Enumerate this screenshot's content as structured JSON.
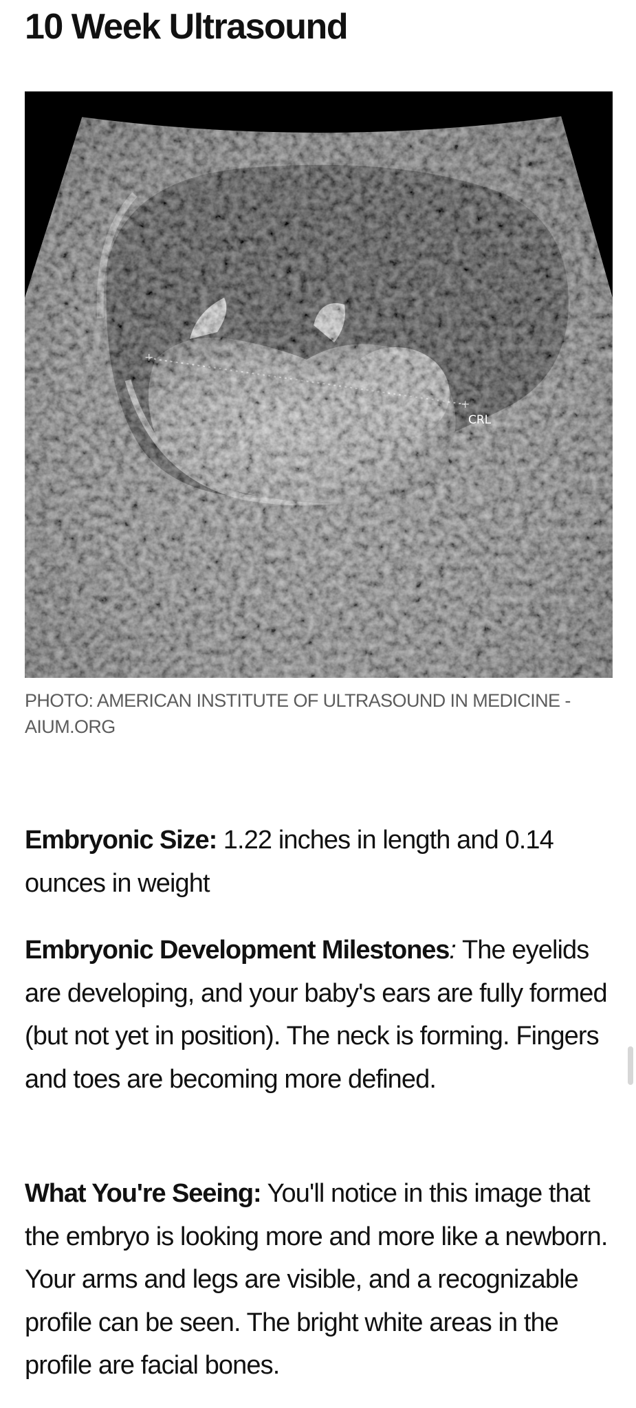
{
  "article": {
    "title": "10 Week Ultrasound",
    "image": {
      "alt": "10 week ultrasound",
      "overlay_label": "CRL"
    },
    "caption": "PHOTO: AMERICAN INSTITUTE OF ULTRASOUND IN MEDICINE - AIUM.ORG",
    "sections": [
      {
        "label": "Embryonic Size:",
        "text": " 1.22 inches in length and 0.14 ounces in weight"
      },
      {
        "label": "Embryonic Development Milestones",
        "label_suffix": ":",
        "text": " The eyelids are developing, and your baby's ears are fully formed (but not yet in position). The neck is forming. Fingers and toes are becoming more defined."
      },
      {
        "label": "What You're Seeing:",
        "text": " You'll notice in this image that the embryo is looking more and more like a newborn. Your arms and legs are visible, and a recognizable profile can be seen. The bright white areas in the profile are facial bones."
      }
    ]
  }
}
